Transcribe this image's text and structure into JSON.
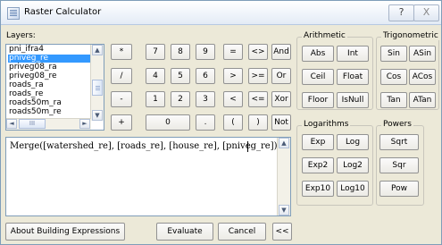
{
  "window": {
    "title": "Raster Calculator",
    "help_button": "?",
    "close_button": "X"
  },
  "layers": {
    "label": "Layers:",
    "items": [
      "pni_ifra4",
      "pniveg_re",
      "priveg08_ra",
      "priveg08_re",
      "roads_ra",
      "roads_re",
      "roads50m_ra",
      "roads50m_re"
    ],
    "selected": "pniveg_re",
    "scroll_left": "◄",
    "scroll_thumb": "III",
    "scroll_right": "►",
    "scroll_up": "▲",
    "scroll_down": "▼"
  },
  "keypad": {
    "row1": [
      "*",
      "7",
      "8",
      "9",
      "=",
      "<>",
      "And"
    ],
    "row2": [
      "/",
      "4",
      "5",
      "6",
      ">",
      ">=",
      "Or"
    ],
    "row3": [
      "-",
      "1",
      "2",
      "3",
      "<",
      "<=",
      "Xor"
    ],
    "row4": [
      "+",
      "0",
      ".",
      "(",
      ")",
      "Not"
    ]
  },
  "arithmetic": {
    "label": "Arithmetic",
    "buttons": [
      "Abs",
      "Int",
      "Ceil",
      "Float",
      "Floor",
      "IsNull"
    ]
  },
  "trigonometric": {
    "label": "Trigonometric",
    "buttons": [
      "Sin",
      "ASin",
      "Cos",
      "ACos",
      "Tan",
      "ATan"
    ]
  },
  "logarithms": {
    "label": "Logarithms",
    "buttons": [
      "Exp",
      "Log",
      "Exp2",
      "Log2",
      "Exp10",
      "Log10"
    ]
  },
  "powers": {
    "label": "Powers",
    "buttons": [
      "Sqrt",
      "Sqr",
      "Pow"
    ]
  },
  "expression": {
    "value": "Merge([watershed_re], [roads_re], [house_re], [pniveg_re])"
  },
  "footer": {
    "about": "About Building Expressions",
    "evaluate": "Evaluate",
    "cancel": "Cancel",
    "collapse": "<<"
  }
}
